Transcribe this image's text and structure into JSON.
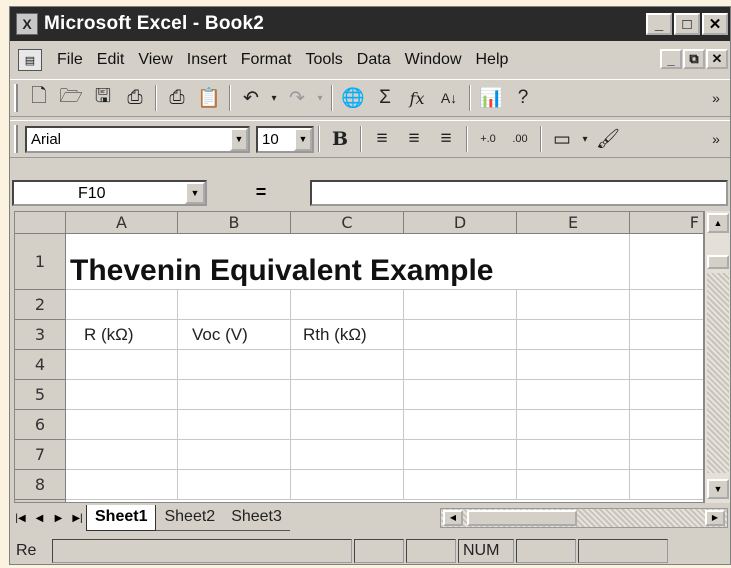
{
  "window": {
    "title": "Microsoft Excel - Book2",
    "min": "_",
    "max": "□",
    "close": "✕"
  },
  "menubar": {
    "items": [
      {
        "label": "File"
      },
      {
        "label": "Edit"
      },
      {
        "label": "View"
      },
      {
        "label": "Insert"
      },
      {
        "label": "Format"
      },
      {
        "label": "Tools"
      },
      {
        "label": "Data"
      },
      {
        "label": "Window"
      },
      {
        "label": "Help"
      }
    ],
    "doc_min": "_",
    "doc_restore": "⧉",
    "doc_close": "✕"
  },
  "toolbar_standard": {
    "icons": [
      "new-icon",
      "open-icon",
      "save-icon",
      "print-preview-icon",
      "print-icon",
      "paste-icon",
      "undo-icon",
      "redo-icon",
      "hyperlink-icon",
      "autosum-icon",
      "function-icon",
      "sort-ascending-icon",
      "chart-wizard-icon",
      "help-icon"
    ]
  },
  "toolbar_formatting": {
    "font": "Arial",
    "size": "10",
    "bold": "B",
    "more": "»"
  },
  "formula_bar": {
    "name_box": "F10",
    "equals": "=",
    "value": ""
  },
  "grid": {
    "columns": [
      "A",
      "B",
      "C",
      "D",
      "E",
      "F"
    ],
    "rows": [
      "1",
      "2",
      "3",
      "4",
      "5",
      "6",
      "7",
      "8"
    ],
    "title_cell": "Thevenin Equivalent Example",
    "row3": [
      "R (kΩ)",
      "Voc (V)",
      "Rth (kΩ)"
    ]
  },
  "sheets": {
    "tabs": [
      "Sheet1",
      "Sheet2",
      "Sheet3"
    ],
    "active": "Sheet1"
  },
  "status": {
    "ready": "Re",
    "num": "NUM"
  }
}
